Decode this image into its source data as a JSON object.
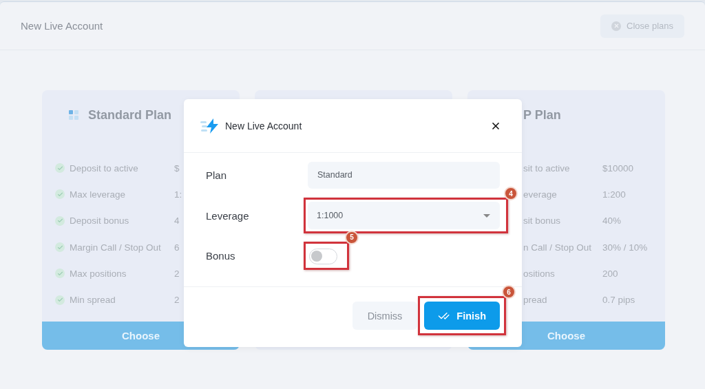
{
  "page": {
    "title": "New Live Account",
    "close_button": "Close plans"
  },
  "plans": [
    {
      "kind": "open",
      "title": "Standard Plan",
      "features": [
        {
          "label": "Deposit to active",
          "value": "$"
        },
        {
          "label": "Max leverage",
          "value": "1:"
        },
        {
          "label": "Deposit bonus",
          "value": "4"
        },
        {
          "label": "Margin Call / Stop Out",
          "value": "6"
        },
        {
          "label": "Max positions",
          "value": "2"
        },
        {
          "label": "Min spread",
          "value": "2"
        }
      ],
      "button": "Choose"
    },
    {
      "kind": "hidden"
    },
    {
      "kind": "clipped",
      "title": "P Plan",
      "features": [
        {
          "label": "sit to active",
          "value": "$10000"
        },
        {
          "label": "everage",
          "value": "1:200"
        },
        {
          "label": "sit bonus",
          "value": "40%"
        },
        {
          "label": "n Call / Stop Out",
          "value": "30% / 10%"
        },
        {
          "label": "ositions",
          "value": "200"
        },
        {
          "label": "pread",
          "value": "0.7 pips"
        }
      ],
      "button": "Choose"
    }
  ],
  "modal": {
    "title": "New Live Account",
    "fields": [
      {
        "kind": "text",
        "label": "Plan",
        "value": "Standard"
      },
      {
        "kind": "select",
        "label": "Leverage",
        "value": "1:1000",
        "annotation": "4"
      },
      {
        "kind": "toggle",
        "label": "Bonus",
        "on": false,
        "annotation": "5"
      }
    ],
    "buttons": [
      {
        "kind": "secondary",
        "label": "Dismiss"
      },
      {
        "kind": "primary",
        "label": "Finish",
        "annotation": "6"
      }
    ]
  }
}
